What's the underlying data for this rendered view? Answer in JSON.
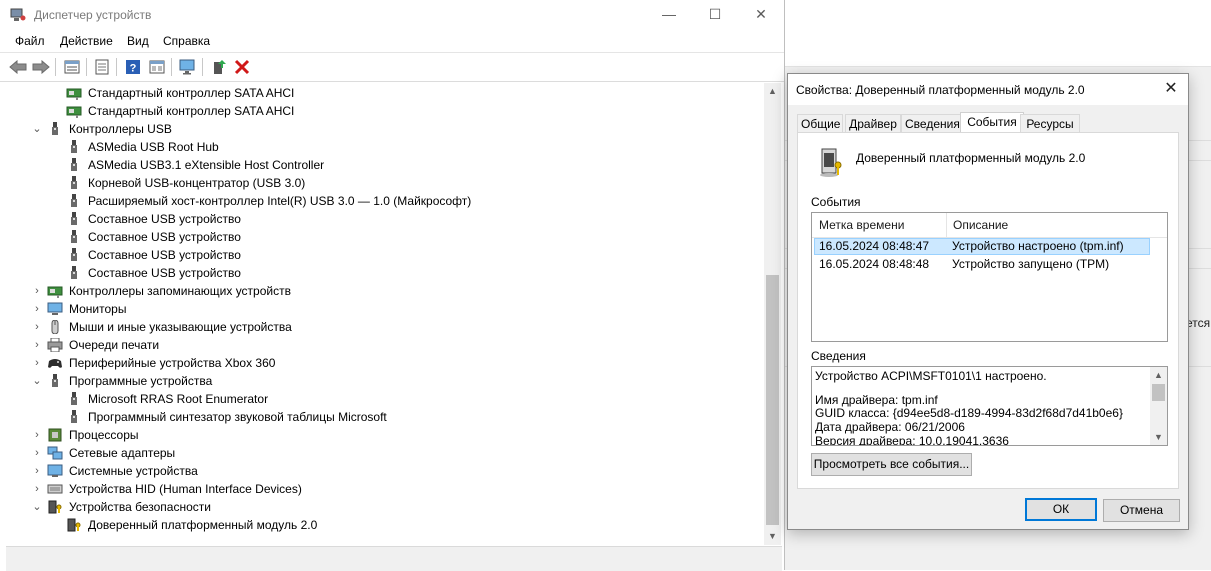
{
  "window": {
    "title": "Диспетчер устройств",
    "minimize": "—",
    "maximize": "☐",
    "close": "✕"
  },
  "menu": [
    "Файл",
    "Действие",
    "Вид",
    "Справка"
  ],
  "toolbar_icons": [
    "back-arrow-icon",
    "forward-arrow-icon",
    "properties-icon",
    "show-hidden-icon",
    "help-icon",
    "view-icon",
    "scan-hardware-icon",
    "update-driver-icon",
    "uninstall-icon"
  ],
  "tree": [
    {
      "label": "Стандартный контроллер SATA AHCI",
      "level": 1,
      "icon": "storage-controller-icon"
    },
    {
      "label": "Стандартный контроллер SATA AHCI",
      "level": 1,
      "icon": "storage-controller-icon"
    },
    {
      "label": "Контроллеры USB",
      "level": 0,
      "expanded": true,
      "icon": "usb-icon"
    },
    {
      "label": "ASMedia USB Root Hub",
      "level": 1,
      "icon": "usb-icon"
    },
    {
      "label": "ASMedia USB3.1 eXtensible Host Controller",
      "level": 1,
      "icon": "usb-icon"
    },
    {
      "label": "Корневой USB-концентратор (USB 3.0)",
      "level": 1,
      "icon": "usb-icon"
    },
    {
      "label": "Расширяемый хост-контроллер Intel(R) USB 3.0 — 1.0 (Майкрософт)",
      "level": 1,
      "icon": "usb-icon"
    },
    {
      "label": "Составное USB устройство",
      "level": 1,
      "icon": "usb-icon"
    },
    {
      "label": "Составное USB устройство",
      "level": 1,
      "icon": "usb-icon"
    },
    {
      "label": "Составное USB устройство",
      "level": 1,
      "icon": "usb-icon"
    },
    {
      "label": "Составное USB устройство",
      "level": 1,
      "icon": "usb-icon"
    },
    {
      "label": "Контроллеры запоминающих устройств",
      "level": 0,
      "expanded": false,
      "icon": "storage-controller-icon"
    },
    {
      "label": "Мониторы",
      "level": 0,
      "expanded": false,
      "icon": "monitor-icon"
    },
    {
      "label": "Мыши и иные указывающие устройства",
      "level": 0,
      "expanded": false,
      "icon": "mouse-icon"
    },
    {
      "label": "Очереди печати",
      "level": 0,
      "expanded": false,
      "icon": "printer-icon"
    },
    {
      "label": "Периферийные устройства Xbox 360",
      "level": 0,
      "expanded": false,
      "icon": "gamepad-icon"
    },
    {
      "label": "Программные устройства",
      "level": 0,
      "expanded": true,
      "icon": "usb-icon"
    },
    {
      "label": "Microsoft RRAS Root Enumerator",
      "level": 1,
      "icon": "usb-icon"
    },
    {
      "label": "Программный синтезатор звуковой таблицы Microsoft",
      "level": 1,
      "icon": "usb-icon"
    },
    {
      "label": "Процессоры",
      "level": 0,
      "expanded": false,
      "icon": "cpu-icon"
    },
    {
      "label": "Сетевые адаптеры",
      "level": 0,
      "expanded": false,
      "icon": "network-icon"
    },
    {
      "label": "Системные устройства",
      "level": 0,
      "expanded": false,
      "icon": "system-device-icon"
    },
    {
      "label": "Устройства HID (Human Interface Devices)",
      "level": 0,
      "expanded": false,
      "icon": "hid-icon"
    },
    {
      "label": "Устройства безопасности",
      "level": 0,
      "expanded": true,
      "icon": "security-device-icon"
    },
    {
      "label": "Доверенный платформенный модуль 2.0",
      "level": 1,
      "icon": "security-device-icon"
    }
  ],
  "dialog": {
    "title": "Свойства: Доверенный платформенный модуль 2.0",
    "close": "✕",
    "tabs": [
      "Общие",
      "Драйвер",
      "Сведения",
      "События",
      "Ресурсы"
    ],
    "active_tab": "События",
    "device_name": "Доверенный платформенный модуль 2.0",
    "events_label": "События",
    "columns": [
      "Метка времени",
      "Описание"
    ],
    "events": [
      {
        "time": "16.05.2024 08:48:47",
        "desc": "Устройство настроено (tpm.inf)"
      },
      {
        "time": "16.05.2024 08:48:48",
        "desc": "Устройство запущено (TPM)"
      }
    ],
    "details_label": "Сведения",
    "details_lines": [
      "Устройство ACPI\\MSFT0101\\1 настроено.",
      "",
      "Имя драйвера: tpm.inf",
      "GUID класса: {d94ee5d8-d189-4994-83d2f68d7d41b0e6}",
      "Дата драйвера: 06/21/2006",
      "Версия драйвера: 10.0.19041.3636"
    ],
    "view_all_button": "Просмотреть все события...",
    "ok_button": "ОК",
    "cancel_button": "Отмена"
  },
  "background": {
    "partial_text": "ется"
  }
}
